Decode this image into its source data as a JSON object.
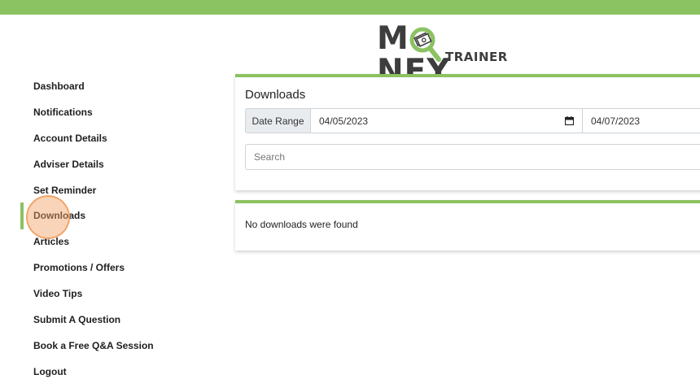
{
  "brand": {
    "name_part1": "M",
    "name_part2": "NEY",
    "subtitle": "TRAINER",
    "accent_color": "#8bc262",
    "logo_icon": "magnifier-money-icon"
  },
  "sidebar": {
    "active_index": 5,
    "items": [
      {
        "label": "Dashboard"
      },
      {
        "label": "Notifications"
      },
      {
        "label": "Account Details"
      },
      {
        "label": "Adviser Details"
      },
      {
        "label": "Set Reminder"
      },
      {
        "label": "Downloads"
      },
      {
        "label": "Articles"
      },
      {
        "label": "Promotions / Offers"
      },
      {
        "label": "Video Tips"
      },
      {
        "label": "Submit A Question"
      },
      {
        "label": "Book a Free Q&A Session"
      },
      {
        "label": "Logout"
      }
    ]
  },
  "downloads": {
    "title": "Downloads",
    "date_range_label": "Date Range",
    "date_from": "04/05/2023",
    "date_to": "04/07/2023",
    "calendar_icon": "calendar-icon",
    "search_placeholder": "Search",
    "empty_message": "No downloads were found"
  }
}
